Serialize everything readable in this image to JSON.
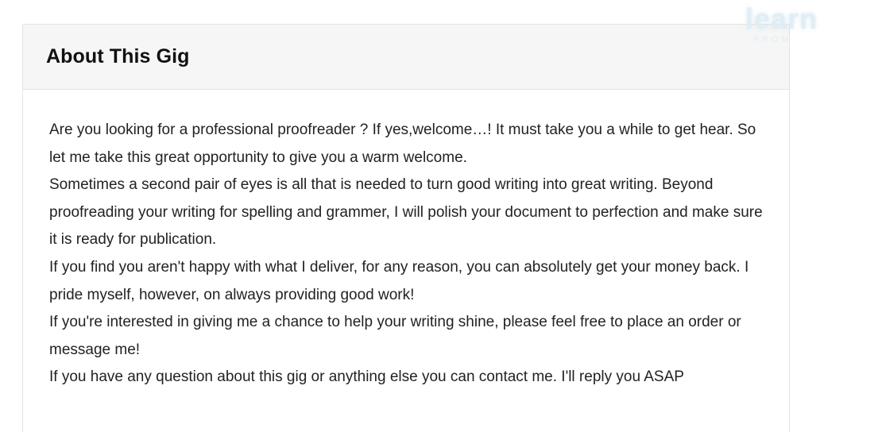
{
  "watermark": {
    "main": "learn",
    "sub": "FROM"
  },
  "gig": {
    "title": "About This Gig",
    "paragraphs": [
      "Are you looking for a professional proofreader ? If yes,welcome…! It must take you a while to get hear. So let me take this great opportunity to give you a warm welcome.",
      "Sometimes a second pair of eyes is all that is needed to turn good writing into great writing. Beyond proofreading your writing for spelling and grammer, I will polish your document to perfection and make sure it is ready for publication.",
      "If you find you aren't happy with what I deliver, for any reason, you can absolutely get your money back. I pride myself, however, on always providing good work!",
      "If you're interested in giving me a chance to help your writing shine, please feel free to place an order or message me!",
      "If you have any question about this gig or anything else you can contact me. I'll reply you ASAP"
    ]
  }
}
